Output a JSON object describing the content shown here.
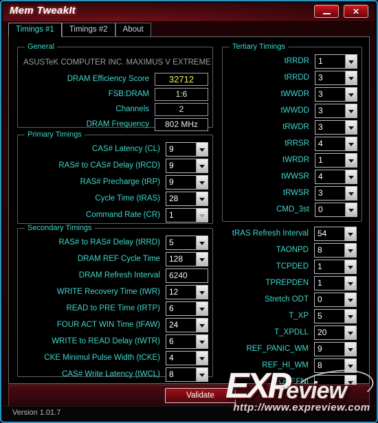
{
  "window": {
    "title": "Mem TweakIt",
    "minimize_label": "",
    "close_label": "✕"
  },
  "tabs": [
    {
      "label": "Timings #1",
      "active": true
    },
    {
      "label": "Timings #2",
      "active": false
    },
    {
      "label": "About",
      "active": false
    }
  ],
  "general": {
    "title": "General",
    "motherboard": "ASUSTeK COMPUTER INC. MAXIMUS V EXTREME",
    "rows": [
      {
        "label": "DRAM Efficiency Score",
        "value": "32712",
        "accent": true
      },
      {
        "label": "FSB:DRAM",
        "value": "1:6",
        "accent": false
      },
      {
        "label": "Channels",
        "value": "2",
        "accent": false
      },
      {
        "label": "DRAM Frequency",
        "value": "802 MHz",
        "accent": false
      }
    ]
  },
  "primary": {
    "title": "Primary Timings",
    "rows": [
      {
        "label": "CAS# Latency (CL)",
        "value": "9",
        "type": "combo",
        "disabled": false
      },
      {
        "label": "RAS# to CAS# Delay (tRCD)",
        "value": "9",
        "type": "combo",
        "disabled": false
      },
      {
        "label": "RAS# Precharge (tRP)",
        "value": "9",
        "type": "combo",
        "disabled": false
      },
      {
        "label": "Cycle Time (tRAS)",
        "value": "28",
        "type": "combo",
        "disabled": false
      },
      {
        "label": "Command Rate (CR)",
        "value": "1",
        "type": "combo",
        "disabled": true
      }
    ]
  },
  "secondary": {
    "title": "Secondary Timings",
    "rows": [
      {
        "label": "RAS# to RAS# Delay (tRRD)",
        "value": "5",
        "type": "combo",
        "disabled": false
      },
      {
        "label": "DRAM REF Cycle Time",
        "value": "128",
        "type": "combo",
        "disabled": false
      },
      {
        "label": "DRAM Refresh Interval",
        "value": "6240",
        "type": "text",
        "disabled": false
      },
      {
        "label": "WRITE Recovery Time (tWR)",
        "value": "12",
        "type": "combo",
        "disabled": false
      },
      {
        "label": "READ to PRE Time (tRTP)",
        "value": "6",
        "type": "combo",
        "disabled": false
      },
      {
        "label": "FOUR ACT WIN Time (tFAW)",
        "value": "24",
        "type": "combo",
        "disabled": false
      },
      {
        "label": "WRITE to READ Delay (tWTR)",
        "value": "6",
        "type": "combo",
        "disabled": false
      },
      {
        "label": "CKE Minimul Pulse Width (tCKE)",
        "value": "4",
        "type": "combo",
        "disabled": false
      },
      {
        "label": "CAS# Write Latency (tWCL)",
        "value": "8",
        "type": "combo",
        "disabled": false
      }
    ]
  },
  "tertiary": {
    "title": "Tertiary Timings",
    "rows": [
      {
        "label": "tRRDR",
        "value": "1",
        "type": "combo",
        "disabled": false
      },
      {
        "label": "tRRDD",
        "value": "3",
        "type": "combo",
        "disabled": false
      },
      {
        "label": "tWWDR",
        "value": "3",
        "type": "combo",
        "disabled": false
      },
      {
        "label": "tWWDD",
        "value": "3",
        "type": "combo",
        "disabled": false
      },
      {
        "label": "tRWDR",
        "value": "3",
        "type": "combo",
        "disabled": false
      },
      {
        "label": "tRRSR",
        "value": "4",
        "type": "combo",
        "disabled": false
      },
      {
        "label": "tWRDR",
        "value": "1",
        "type": "combo",
        "disabled": false
      },
      {
        "label": "tWWSR",
        "value": "4",
        "type": "combo",
        "disabled": false
      },
      {
        "label": "tRWSR",
        "value": "3",
        "type": "combo",
        "disabled": false
      },
      {
        "label": "CMD_3st",
        "value": "0",
        "type": "combo",
        "disabled": false
      }
    ]
  },
  "misc": {
    "rows": [
      {
        "label": "tRAS Refresh Interval",
        "value": "54",
        "type": "combo",
        "disabled": false
      },
      {
        "label": "TAONPD",
        "value": "8",
        "type": "combo",
        "disabled": false
      },
      {
        "label": "TCPDED",
        "value": "1",
        "type": "combo",
        "disabled": false
      },
      {
        "label": "TPREPDEN",
        "value": "1",
        "type": "combo",
        "disabled": false
      },
      {
        "label": "Stretch ODT",
        "value": "0",
        "type": "combo",
        "disabled": false
      },
      {
        "label": "T_XP",
        "value": "5",
        "type": "combo",
        "disabled": false
      },
      {
        "label": "T_XPDLL",
        "value": "20",
        "type": "combo",
        "disabled": false
      },
      {
        "label": "REF_PANIC_WM",
        "value": "9",
        "type": "combo",
        "disabled": false
      },
      {
        "label": "REF_HI_WM",
        "value": "8",
        "type": "combo",
        "disabled": false
      },
      {
        "label": "OREFNI",
        "value": "",
        "type": "combo",
        "disabled": false
      }
    ]
  },
  "bottom": {
    "validate_label": "Validate",
    "version": "Version 1.01.7"
  },
  "watermark": {
    "brand_ex": "EXP",
    "brand_review": "review",
    "url": "http://www.expreview.com"
  },
  "colors": {
    "accent_cyan": "#3fd8cf",
    "accent_yellow": "#f2f24a",
    "brand_red": "#9e1018",
    "window_border": "#2b93c4"
  }
}
